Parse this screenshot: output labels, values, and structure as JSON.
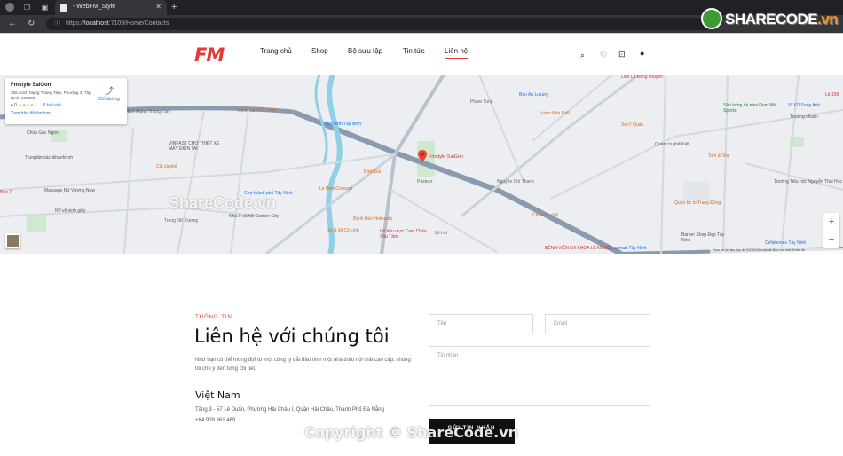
{
  "browser": {
    "tab_title": "- WebFM_Style",
    "url_host": "localhost",
    "url_rest": ":7109/Home/Contacts"
  },
  "watermark": {
    "logo_main": "SHARECODE",
    "logo_tld": ".vn",
    "center": "ShareCode.vn",
    "bottom": "Copyright © ShareCode.vn"
  },
  "header": {
    "logo": "FM",
    "menu": [
      "Trang chủ",
      "Shop",
      "Bộ sưu tập",
      "Tin tức",
      "Liên hệ"
    ],
    "active_item": "Liên hệ",
    "icons": [
      "search-icon",
      "heart-icon",
      "bag-icon",
      "user-icon"
    ]
  },
  "map": {
    "card": {
      "name": "Fmstyle SaiGon",
      "address": "355 Cách Mạng Tháng Tám, Phường 3, Tây Ninh, 100000",
      "rating": "4,0",
      "stars": "★★★★☆",
      "reviews": "6 bài viết",
      "bigger_map": "Xem bản đồ lớn hơn",
      "directions": "Chỉ đường"
    },
    "pin_label": "Fmstyle SaiGon",
    "labels": [
      {
        "text": "Cách Mạng Tháng Tám",
        "cls": "street"
      },
      {
        "text": "Bánh canh Út Thiện",
        "cls": "orange"
      },
      {
        "text": "Chợ đêm Tây Ninh",
        "cls": "blue"
      },
      {
        "text": "Chùa Gác Ngon",
        "cls": ""
      },
      {
        "text": "Trungtâmsáchkhánhrình",
        "cls": ""
      },
      {
        "text": "VINFAST CHỢ THIẾT XE MÁY ĐIỆN TAI",
        "cls": ""
      },
      {
        "text": "Cũi cà phê",
        "cls": "orange"
      },
      {
        "text": "Massage Nữ Vương New",
        "cls": ""
      },
      {
        "text": "NT-vệ sinh giày",
        "cls": ""
      },
      {
        "text": "Bảo 2",
        "cls": "red"
      },
      {
        "text": "Trung Nữ Vương",
        "cls": "street"
      },
      {
        "text": "Chợ thành phố Tây Ninh",
        "cls": "blue"
      },
      {
        "text": "Le Petit Concept",
        "cls": "orange"
      },
      {
        "text": "Nhà ở xã hội Golden City",
        "cls": ""
      },
      {
        "text": "Bò lá lốt Cô Linh",
        "cls": "orange"
      },
      {
        "text": "Bánh Bún Hokkaido",
        "cls": "orange"
      },
      {
        "text": "Hủ tiếu mực Cam Cháo Sáu Tám",
        "cls": "red"
      },
      {
        "text": "Bình Đại",
        "cls": "orange"
      },
      {
        "text": "Bao An Luxury",
        "cls": "blue"
      },
      {
        "text": "Vườn Nhà Grill",
        "cls": "orange"
      },
      {
        "text": "Sen7 Quán",
        "cls": "orange"
      },
      {
        "text": "Linh Lê Bông chuyền",
        "cls": "red"
      },
      {
        "text": "Tom & Tea",
        "cls": "orange"
      },
      {
        "text": "Quán bò to Trung Đông",
        "cls": "orange"
      },
      {
        "text": "Barber Shop Đẹp Tây Ninh",
        "cls": ""
      },
      {
        "text": "Chu's cà phê",
        "cls": "orange"
      },
      {
        "text": "BỆNH VIỆN ĐA KHOA LÊ NGỌC",
        "cls": "red"
      },
      {
        "text": "Co.opmart Tây Ninh",
        "cls": "blue"
      },
      {
        "text": "Trường Tiểu học Nguyễn Thái Học",
        "cls": ""
      },
      {
        "text": "Sân bóng đá mini Đam Mê Sports",
        "cls": "green"
      },
      {
        "text": "VLXD Song Anh",
        "cls": "blue"
      },
      {
        "text": "Trường chuẩn",
        "cls": ""
      },
      {
        "text": "Cellphones Tây Ninh",
        "cls": "blue"
      },
      {
        "text": "Phạm Tung",
        "cls": "street"
      },
      {
        "text": "Nguyễn Chí Thanh",
        "cls": "street"
      },
      {
        "text": "Pasteur",
        "cls": "street"
      },
      {
        "text": "Quán cà phê Kiệt",
        "cls": ""
      },
      {
        "text": "Lê Lợi",
        "cls": "street"
      },
      {
        "text": "Lê 199",
        "cls": "red"
      }
    ],
    "footer": "Phím tắt  Dữ liệu bản đồ ©2025  Điều khoản  Báo cáo một lỗi bản đồ"
  },
  "contact": {
    "eyebrow": "THÔNG TIN",
    "title": "Liên hệ với chúng tôi",
    "description": "Như bạn có thể mong đợi từ một công ty bắt đầu như một nhà thầu nội thất cao cấp, chúng tôi chú ý đến từng chi tiết.",
    "country": "Việt Nam",
    "address": "Tầng 3 - 57 Lê Duẩn, Phường Hải Châu I, Quận Hải Châu, Thành Phố Đà Nẵng",
    "phone": "+84 909 861 469",
    "form": {
      "name_placeholder": "Tên",
      "email_placeholder": "Email",
      "message_placeholder": "Tin nhắn",
      "send_label": "GỬI TIN NHẮN"
    }
  }
}
